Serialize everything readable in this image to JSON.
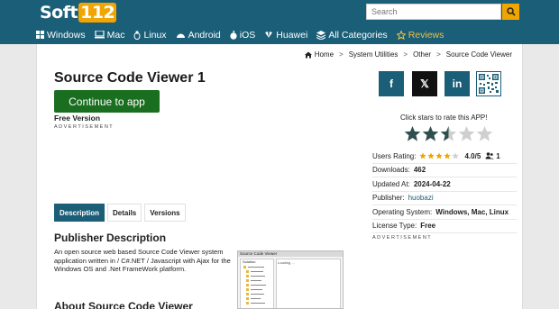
{
  "header": {
    "logo_text": "Soft",
    "logo_number": "112",
    "search_placeholder": "Search"
  },
  "nav": [
    {
      "label": "Windows",
      "icon": "windows-icon"
    },
    {
      "label": "Mac",
      "icon": "mac-icon"
    },
    {
      "label": "Linux",
      "icon": "linux-icon"
    },
    {
      "label": "Android",
      "icon": "android-icon"
    },
    {
      "label": "iOS",
      "icon": "apple-icon"
    },
    {
      "label": "Huawei",
      "icon": "huawei-icon"
    },
    {
      "label": "All Categories",
      "icon": "layers-icon"
    },
    {
      "label": "Reviews",
      "icon": "star-icon"
    }
  ],
  "breadcrumb": {
    "home": "Home",
    "sep": ">",
    "c1": "System Utilities",
    "c2": "Other",
    "c3": "Source Code Viewer"
  },
  "app": {
    "title": "Source Code Viewer 1",
    "cta": "Continue to app",
    "license_label": "Free Version",
    "advertisement": "ADVERTISEMENT"
  },
  "tabs": [
    "Description",
    "Details",
    "Versions"
  ],
  "publisher_section": {
    "heading": "Publisher Description",
    "text": "An open source web based Source Code Viewer system application written in / C#.NET / Javascript with Ajax for the Windows OS and .Net FrameWork platform.",
    "about_heading": "About Source Code Viewer"
  },
  "screenshot": {
    "title": "Source Code Viewer",
    "panel_left": "Solution",
    "panel_right": "Loading ..."
  },
  "social": {
    "facebook": "f",
    "x": "𝕏",
    "linkedin": "in"
  },
  "rating": {
    "prompt": "Click stars to rate this APP!",
    "stars_filled": 2.5,
    "stars_total": 5
  },
  "info": {
    "users_rating_label": "Users Rating:",
    "users_rating_value": "4.0/5",
    "users_rating_stars": 4,
    "users_count": "1",
    "downloads_label": "Downloads:",
    "downloads_value": "462",
    "updated_label": "Updated At:",
    "updated_value": "2024-04-22",
    "publisher_label": "Publisher:",
    "publisher_value": "huobazi",
    "os_label": "Operating System:",
    "os_value": "Windows, Mac, Linux",
    "license_label": "License Type:",
    "license_value": "Free"
  },
  "colors": {
    "brand": "#1b5e77",
    "accent": "#f0a500",
    "cta": "#1a6e1f",
    "star": "#f0a500",
    "star_dark": "#2f4f4f"
  }
}
